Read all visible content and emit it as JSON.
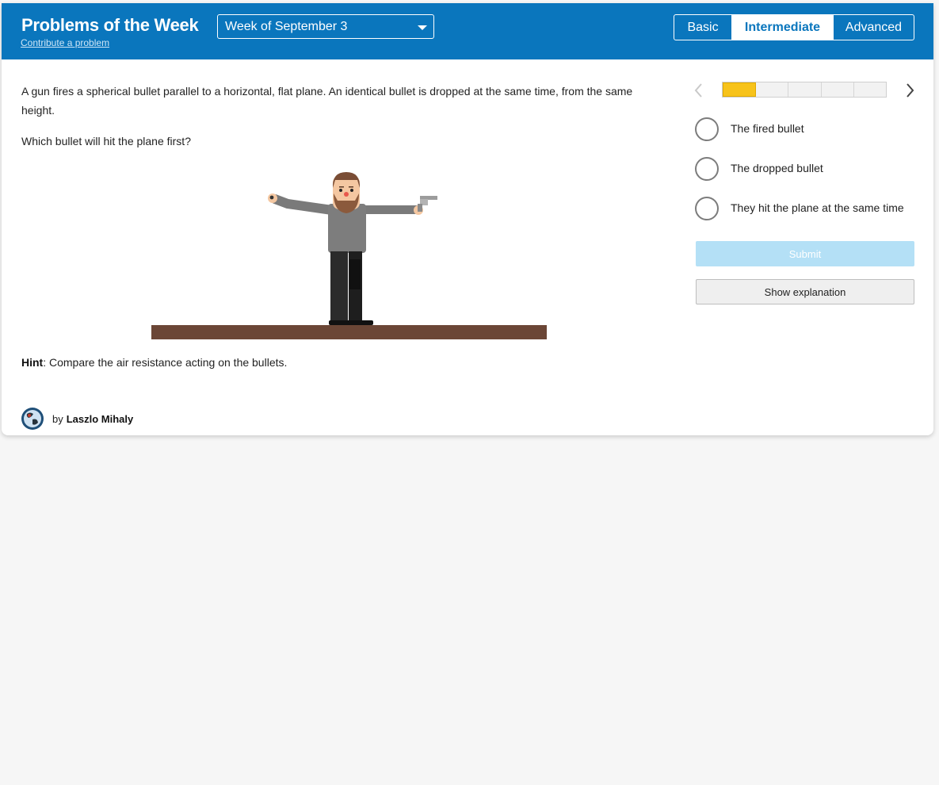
{
  "header": {
    "title": "Problems of the Week",
    "contribute_label": "Contribute a problem",
    "week_select": {
      "selected": "Week of September 3"
    },
    "levels": [
      {
        "label": "Basic",
        "active": false
      },
      {
        "label": "Intermediate",
        "active": true
      },
      {
        "label": "Advanced",
        "active": false
      }
    ]
  },
  "problem": {
    "text": "A gun fires a spherical bullet parallel to a horizontal, flat plane. An identical bullet is dropped at the same time, from the same height.",
    "question": "Which bullet will hit the plane first?",
    "hint_label": "Hint",
    "hint_text": ": Compare the air resistance acting on the bullets."
  },
  "author": {
    "by_label": "by",
    "name": "Laszlo Mihaly",
    "avatar_icon": "globe-icon"
  },
  "progress": {
    "current": 1,
    "total": 5,
    "fill_color": "#f7c31b"
  },
  "options": [
    {
      "label": "The fired bullet"
    },
    {
      "label": "The dropped bullet"
    },
    {
      "label": "They hit the plane at the same time"
    }
  ],
  "buttons": {
    "submit_label": "Submit",
    "explanation_label": "Show explanation"
  },
  "colors": {
    "brand_blue": "#0a76bd",
    "submit_disabled": "#b4e0f6",
    "ground": "#6b4636"
  }
}
